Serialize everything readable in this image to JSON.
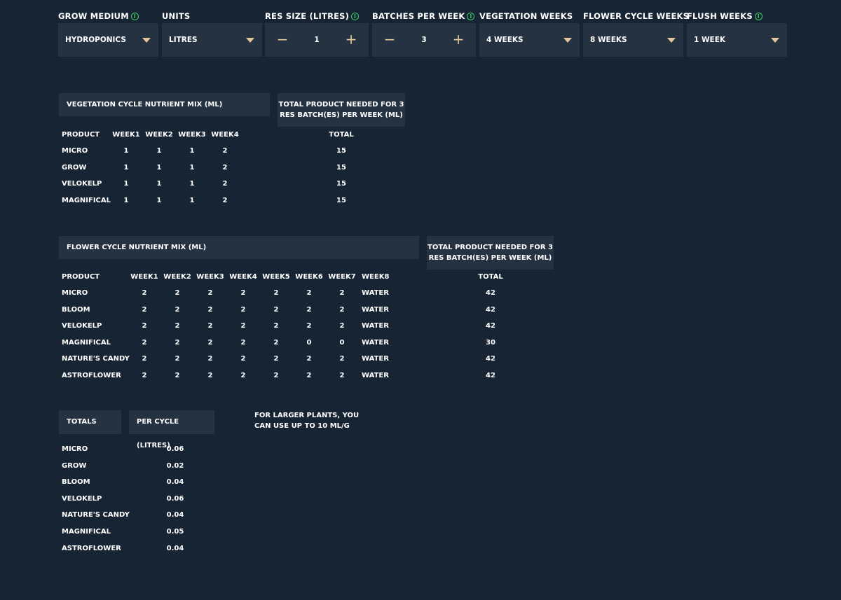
{
  "controls": {
    "grow_medium": {
      "label": "GROW MEDIUM",
      "value": "HYDROPONICS"
    },
    "units": {
      "label": "UNITS",
      "value": "LITRES"
    },
    "res_size": {
      "label": "RES SIZE (LITRES)",
      "value": "1",
      "minus": "−",
      "plus": "+"
    },
    "batches": {
      "label": "BATCHES PER WEEK",
      "value": "3",
      "minus": "−",
      "plus": "+"
    },
    "veg_weeks": {
      "label": "VEGETATION WEEKS",
      "value": "4 WEEKS"
    },
    "flower_weeks": {
      "label": "FLOWER CYCLE WEEKS",
      "value": "8 WEEKS"
    },
    "flush_weeks": {
      "label": "FLUSH WEEKS",
      "value": "1 WEEK"
    },
    "info_glyph": "i"
  },
  "veg": {
    "title": "VEGETATION CYCLE NUTRIENT MIX (ML)",
    "total_title_1": "TOTAL PRODUCT NEEDED FOR 3",
    "total_title_2": "RES BATCH(ES) PER WEEK (ML)",
    "headers": [
      "PRODUCT",
      "WEEK1",
      "WEEK2",
      "WEEK3",
      "WEEK4",
      "TOTAL"
    ],
    "rows": [
      {
        "product": "MICRO",
        "weeks": [
          "1",
          "1",
          "1",
          "2"
        ],
        "total": "15"
      },
      {
        "product": "GROW",
        "weeks": [
          "1",
          "1",
          "1",
          "2"
        ],
        "total": "15"
      },
      {
        "product": "VELOKELP",
        "weeks": [
          "1",
          "1",
          "1",
          "2"
        ],
        "total": "15"
      },
      {
        "product": "MAGNIFICAL",
        "weeks": [
          "1",
          "1",
          "1",
          "2"
        ],
        "total": "15"
      }
    ]
  },
  "flower": {
    "title": "FLOWER CYCLE NUTRIENT MIX (ML)",
    "total_title_1": "TOTAL PRODUCT NEEDED FOR 3",
    "total_title_2": "RES BATCH(ES) PER WEEK (ML)",
    "headers": [
      "PRODUCT",
      "WEEK1",
      "WEEK2",
      "WEEK3",
      "WEEK4",
      "WEEK5",
      "WEEK6",
      "WEEK7",
      "WEEK8",
      "TOTAL"
    ],
    "rows": [
      {
        "product": "MICRO",
        "weeks": [
          "2",
          "2",
          "2",
          "2",
          "2",
          "2",
          "2",
          "WATER"
        ],
        "total": "42"
      },
      {
        "product": "BLOOM",
        "weeks": [
          "2",
          "2",
          "2",
          "2",
          "2",
          "2",
          "2",
          "WATER"
        ],
        "total": "42"
      },
      {
        "product": "VELOKELP",
        "weeks": [
          "2",
          "2",
          "2",
          "2",
          "2",
          "2",
          "2",
          "WATER"
        ],
        "total": "42"
      },
      {
        "product": "MAGNIFICAL",
        "weeks": [
          "2",
          "2",
          "2",
          "2",
          "2",
          "0",
          "0",
          "WATER"
        ],
        "total": "30"
      },
      {
        "product": "NATURE'S CANDY",
        "weeks": [
          "2",
          "2",
          "2",
          "2",
          "2",
          "2",
          "2",
          "WATER"
        ],
        "total": "42"
      },
      {
        "product": "ASTROFLOWER",
        "weeks": [
          "2",
          "2",
          "2",
          "2",
          "2",
          "2",
          "2",
          "WATER"
        ],
        "total": "42"
      }
    ]
  },
  "totals": {
    "title": "TOTALS",
    "per_cycle_title": "PER CYCLE (LITRES)",
    "note_1": "FOR LARGER PLANTS, YOU",
    "note_2": "CAN USE UP TO 10 ML/G",
    "rows": [
      {
        "product": "MICRO",
        "value": "0.06"
      },
      {
        "product": "GROW",
        "value": "0.02"
      },
      {
        "product": "BLOOM",
        "value": "0.04"
      },
      {
        "product": "VELOKELP",
        "value": "0.06"
      },
      {
        "product": "NATURE'S CANDY",
        "value": "0.04"
      },
      {
        "product": "MAGNIFICAL",
        "value": "0.05"
      },
      {
        "product": "ASTROFLOWER",
        "value": "0.04"
      }
    ]
  },
  "colors": {
    "background": "#172434",
    "panel": "#253241",
    "accent": "#e3c69b",
    "info": "#3fd26b"
  }
}
